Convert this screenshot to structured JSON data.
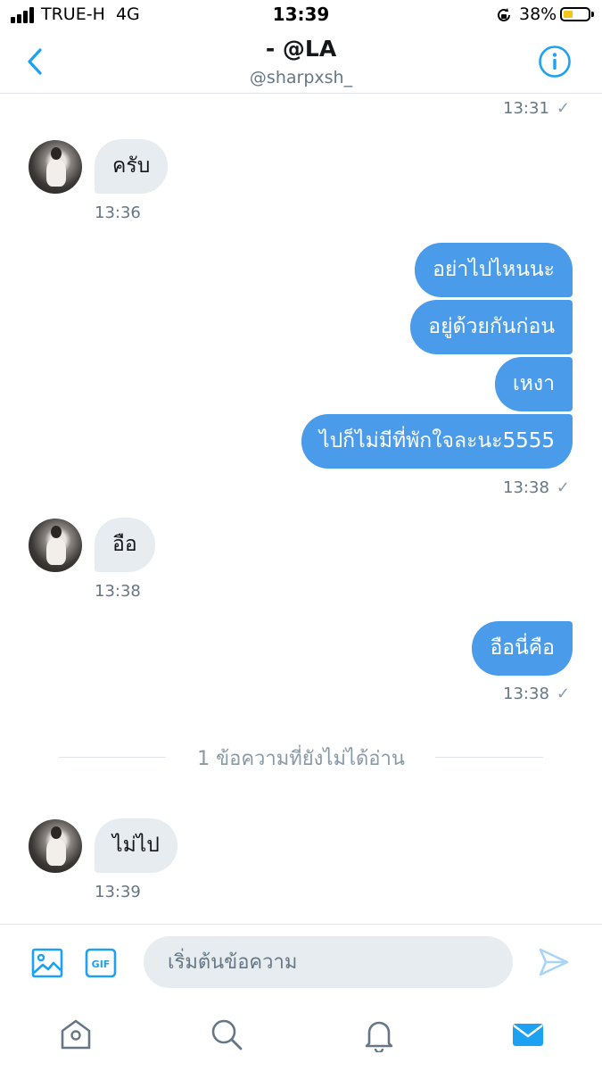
{
  "status_bar": {
    "carrier": "TRUE-H",
    "network": "4G",
    "time": "13:39",
    "battery_percent": "38%",
    "battery_level": 0.38,
    "battery_color": "#f5c518"
  },
  "header": {
    "title": "- @LA",
    "subtitle": "@sharpxsh_",
    "back_icon": "chevron-left-icon",
    "info_icon": "info-icon",
    "accent": "#1da1f2"
  },
  "messages": {
    "top_time": "13:31",
    "m1": {
      "text": "ครับ",
      "time": "13:36"
    },
    "group2": {
      "lines": [
        "อย่าไปไหนนะ",
        "อยู่ด้วยกันก่อน",
        "เหงา",
        "ไปก็ไม่มีที่พักใจละนะ5555"
      ],
      "time": "13:38"
    },
    "m3": {
      "text": "อือ",
      "time": "13:38"
    },
    "m4": {
      "text": "อือนี่คือ",
      "time": "13:38"
    },
    "unread_divider": "1 ข้อความที่ยังไม่ได้อ่าน",
    "m5": {
      "text": "ไม่ไป",
      "time": "13:39"
    },
    "read_mark": "✓",
    "outgoing_color": "#4a9be9",
    "incoming_color": "#e6ecf0"
  },
  "composer": {
    "placeholder": "เริ่มต้นข้อความ",
    "value": "",
    "gif_label": "GIF"
  },
  "tabbar": {
    "icons": [
      "home-icon",
      "search-icon",
      "notifications-icon",
      "messages-icon"
    ],
    "active": "messages-icon"
  }
}
